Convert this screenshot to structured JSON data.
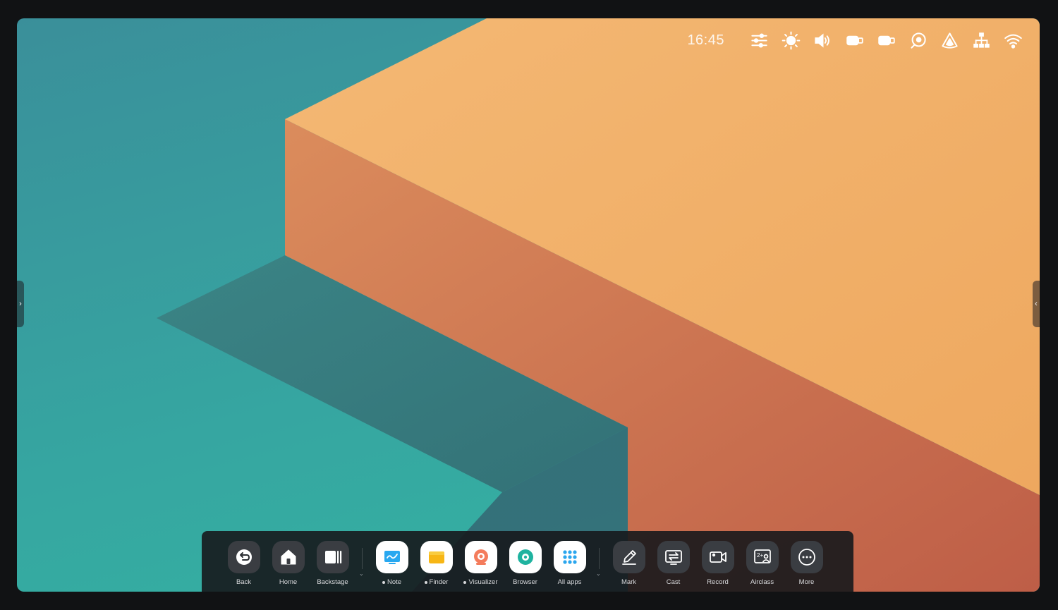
{
  "status_bar": {
    "time": "16:45",
    "icons": [
      "sliders-icon",
      "brightness-icon",
      "volume-icon",
      "usb-icon",
      "usb-icon",
      "disc-icon",
      "cloud-app-icon",
      "network-icon",
      "wifi-icon"
    ]
  },
  "dock": {
    "system": [
      {
        "label": "Back",
        "icon": "back-icon"
      },
      {
        "label": "Home",
        "icon": "home-icon"
      },
      {
        "label": "Backstage",
        "icon": "backstage-icon"
      }
    ],
    "apps": [
      {
        "label": "Note",
        "icon": "note-app-icon",
        "dot": true
      },
      {
        "label": "Finder",
        "icon": "folder-app-icon",
        "dot": true
      },
      {
        "label": "Visualizer",
        "icon": "camera-app-icon",
        "dot": true
      },
      {
        "label": "Browser",
        "icon": "browser-app-icon",
        "dot": false
      },
      {
        "label": "All apps",
        "icon": "grid-icon",
        "dot": false
      }
    ],
    "tools": [
      {
        "label": "Mark",
        "icon": "pen-icon"
      },
      {
        "label": "Cast",
        "icon": "cast-icon"
      },
      {
        "label": "Record",
        "icon": "record-icon"
      },
      {
        "label": "Airclass",
        "icon": "airclass-icon"
      },
      {
        "label": "More",
        "icon": "more-icon"
      }
    ]
  },
  "colors": {
    "wallpaper_teal": "#35a9a2",
    "wallpaper_orange_top": "#f2b06e",
    "wallpaper_orange_side": "#c9694c",
    "dock_bg": "#16181c"
  }
}
